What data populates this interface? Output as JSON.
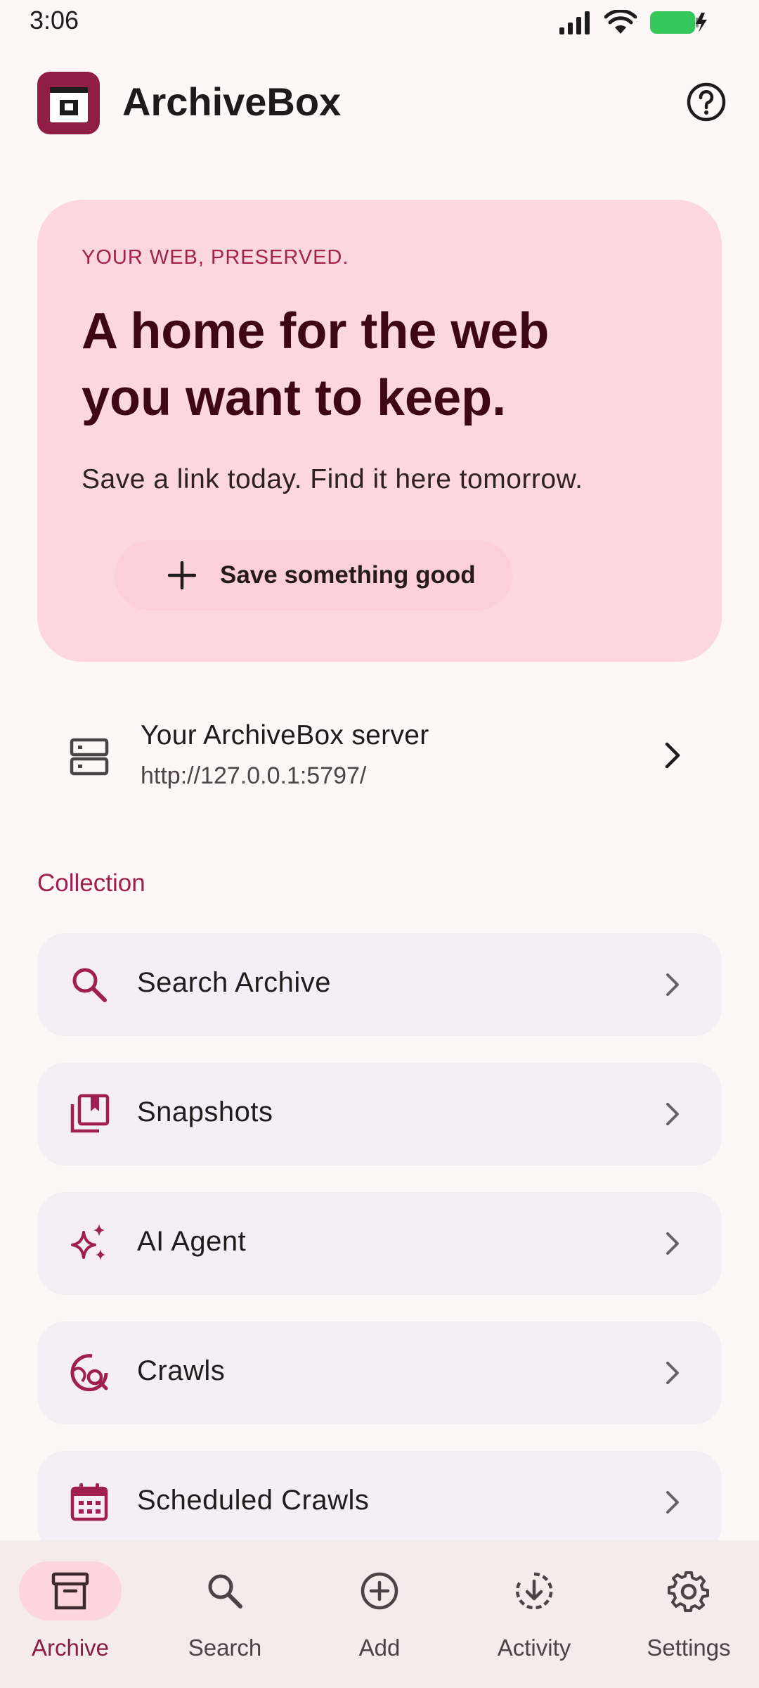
{
  "status_bar": {
    "time": "3:06"
  },
  "app_bar": {
    "title": "ArchiveBox",
    "logo_icon": "archive-box-logo",
    "help_icon": "help-circle-icon"
  },
  "hero": {
    "eyebrow": "YOUR WEB, PRESERVED.",
    "headline_line1": "A home for the web",
    "headline_line2": "you want to keep.",
    "subtitle": "Save a link today. Find it here tomorrow.",
    "button_label": "Save something good",
    "button_icon": "plus-icon"
  },
  "server": {
    "title": "Your ArchiveBox server",
    "url": "http://127.0.0.1:5797/",
    "icon": "server-icon"
  },
  "collection": {
    "title": "Collection",
    "items": [
      {
        "label": "Search Archive",
        "icon": "search-icon"
      },
      {
        "label": "Snapshots",
        "icon": "bookmark-stack-icon"
      },
      {
        "label": "AI Agent",
        "icon": "sparkle-icon"
      },
      {
        "label": "Crawls",
        "icon": "globe-search-icon"
      },
      {
        "label": "Scheduled Crawls",
        "icon": "calendar-icon"
      }
    ]
  },
  "bottom_nav": {
    "items": [
      {
        "label": "Archive",
        "icon": "archive-icon",
        "active": true
      },
      {
        "label": "Search",
        "icon": "search-icon",
        "active": false
      },
      {
        "label": "Add",
        "icon": "add-circle-icon",
        "active": false
      },
      {
        "label": "Activity",
        "icon": "download-circle-icon",
        "active": false
      },
      {
        "label": "Settings",
        "icon": "gear-icon",
        "active": false
      }
    ]
  },
  "colors": {
    "accent": "#9f2050",
    "hero_background": "#fdd7e0",
    "list_background": "#f6eef5",
    "nav_background": "#f5eaec",
    "battery": "#34c759"
  }
}
